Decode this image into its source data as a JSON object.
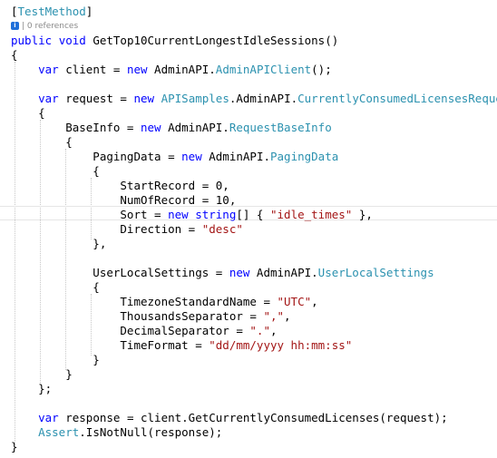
{
  "codelens": {
    "icon": "info-icon",
    "label": "| 0 references"
  },
  "colors": {
    "keyword": "#0000ff",
    "type": "#2b91af",
    "string": "#a31515",
    "plain": "#000000",
    "codelens": "#8a8a8a"
  },
  "lines": [
    [
      [
        "[",
        "p"
      ],
      [
        "TestMethod",
        "t"
      ],
      [
        "]",
        "p"
      ]
    ],
    [
      [
        "public",
        "k"
      ],
      [
        " ",
        "p"
      ],
      [
        "void",
        "k"
      ],
      [
        " GetTop10CurrentLongestIdleSessions()",
        "p"
      ]
    ],
    [
      [
        "{",
        "p"
      ]
    ],
    [
      [
        "    ",
        "p"
      ],
      [
        "var",
        "k"
      ],
      [
        " client = ",
        "p"
      ],
      [
        "new",
        "k"
      ],
      [
        " AdminAPI.",
        "p"
      ],
      [
        "AdminAPIClient",
        "t"
      ],
      [
        "();",
        "p"
      ]
    ],
    [],
    [
      [
        "    ",
        "p"
      ],
      [
        "var",
        "k"
      ],
      [
        " request = ",
        "p"
      ],
      [
        "new",
        "k"
      ],
      [
        " ",
        "p"
      ],
      [
        "APISamples",
        "t"
      ],
      [
        ".AdminAPI.",
        "p"
      ],
      [
        "CurrentlyConsumedLicensesRequest",
        "t"
      ]
    ],
    [
      [
        "    {",
        "p"
      ]
    ],
    [
      [
        "        BaseInfo = ",
        "p"
      ],
      [
        "new",
        "k"
      ],
      [
        " AdminAPI.",
        "p"
      ],
      [
        "RequestBaseInfo",
        "t"
      ]
    ],
    [
      [
        "        {",
        "p"
      ]
    ],
    [
      [
        "            PagingData = ",
        "p"
      ],
      [
        "new",
        "k"
      ],
      [
        " AdminAPI.",
        "p"
      ],
      [
        "PagingData",
        "t"
      ]
    ],
    [
      [
        "            {",
        "p"
      ]
    ],
    [
      [
        "                StartRecord = 0,",
        "p"
      ]
    ],
    [
      [
        "                NumOfRecord = 10,",
        "p"
      ]
    ],
    [
      [
        "                Sort = ",
        "p"
      ],
      [
        "new",
        "k"
      ],
      [
        " ",
        "p"
      ],
      [
        "string",
        "k"
      ],
      [
        "[] { ",
        "p"
      ],
      [
        "\"idle_times\"",
        "s"
      ],
      [
        " },",
        "p"
      ]
    ],
    [
      [
        "                Direction = ",
        "p"
      ],
      [
        "\"desc\"",
        "s"
      ]
    ],
    [
      [
        "            },",
        "p"
      ]
    ],
    [],
    [
      [
        "            UserLocalSettings = ",
        "p"
      ],
      [
        "new",
        "k"
      ],
      [
        " AdminAPI.",
        "p"
      ],
      [
        "UserLocalSettings",
        "t"
      ]
    ],
    [
      [
        "            {",
        "p"
      ]
    ],
    [
      [
        "                TimezoneStandardName = ",
        "p"
      ],
      [
        "\"UTC\"",
        "s"
      ],
      [
        ",",
        "p"
      ]
    ],
    [
      [
        "                ThousandsSeparator = ",
        "p"
      ],
      [
        "\",\"",
        "s"
      ],
      [
        ",",
        "p"
      ]
    ],
    [
      [
        "                DecimalSeparator = ",
        "p"
      ],
      [
        "\".\"",
        "s"
      ],
      [
        ",",
        "p"
      ]
    ],
    [
      [
        "                TimeFormat = ",
        "p"
      ],
      [
        "\"dd/mm/yyyy hh:mm:ss\"",
        "s"
      ]
    ],
    [
      [
        "            }",
        "p"
      ]
    ],
    [
      [
        "        }",
        "p"
      ]
    ],
    [
      [
        "    };",
        "p"
      ]
    ],
    [],
    [
      [
        "    ",
        "p"
      ],
      [
        "var",
        "k"
      ],
      [
        " response = client.GetCurrentlyConsumedLicenses(request);",
        "p"
      ]
    ],
    [
      [
        "    ",
        "p"
      ],
      [
        "Assert",
        "t"
      ],
      [
        ".IsNotNull(response);",
        "p"
      ]
    ],
    [
      [
        "}",
        "p"
      ]
    ]
  ]
}
